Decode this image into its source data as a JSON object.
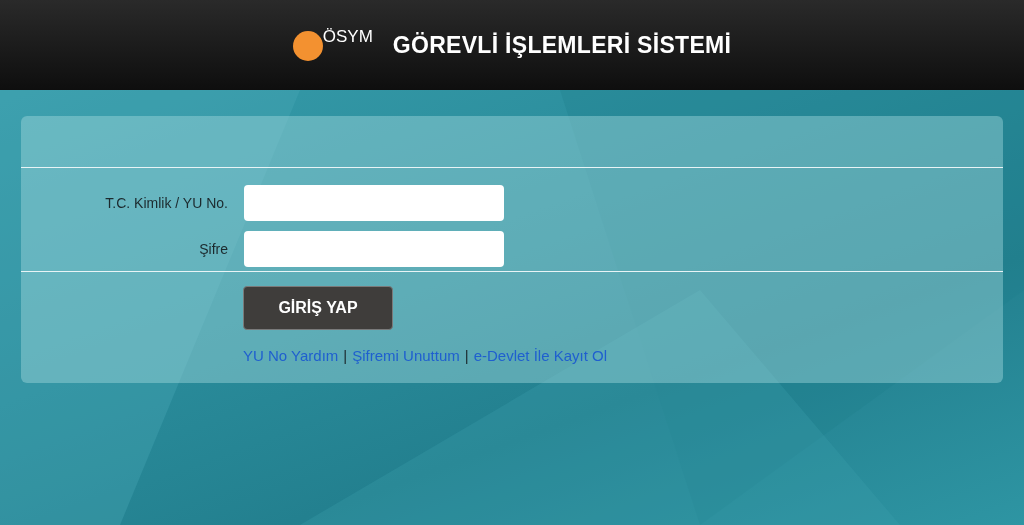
{
  "header": {
    "logo_text": "ÖSYM",
    "title": "GÖREVLİ İŞLEMLERİ SİSTEMİ"
  },
  "form": {
    "fields": [
      {
        "label": "T.C. Kimlik / YU No."
      },
      {
        "label": "Şifre"
      }
    ],
    "submit": "GİRİŞ YAP",
    "links": [
      {
        "kind": "link",
        "text": "YU No Yardım"
      },
      {
        "kind": "separator",
        "text": "|"
      },
      {
        "kind": "link",
        "text": "Şifremi Unuttum"
      },
      {
        "kind": "separator",
        "text": "|"
      },
      {
        "kind": "link",
        "text": "e-Devlet İle Kayıt Ol"
      }
    ]
  }
}
